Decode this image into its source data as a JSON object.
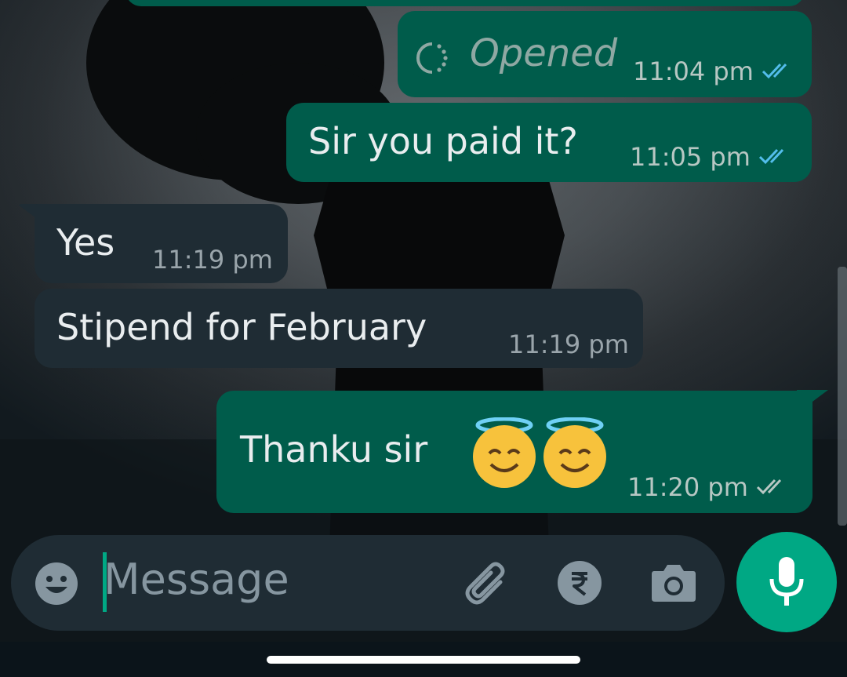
{
  "messages": [
    {
      "direction": "outgoing",
      "type": "view_once",
      "text": "Opened",
      "time": "11:04 pm",
      "status": "read"
    },
    {
      "direction": "outgoing",
      "type": "text",
      "text": "Sir you paid it?",
      "time": "11:05 pm",
      "status": "read"
    },
    {
      "direction": "incoming",
      "type": "text",
      "text": "Yes",
      "time": "11:19 pm"
    },
    {
      "direction": "incoming",
      "type": "text",
      "text": "Stipend for February",
      "time": "11:19 pm"
    },
    {
      "direction": "outgoing",
      "type": "text",
      "text": "Thanku sir",
      "emoji": [
        "smiling-face-with-halo",
        "smiling-face-with-halo"
      ],
      "time": "11:20 pm",
      "status": "delivered"
    }
  ],
  "composer": {
    "placeholder": "Message",
    "icons": [
      "emoji-icon",
      "attach-icon",
      "rupee-payment-icon",
      "camera-icon",
      "mic-icon"
    ]
  },
  "colors": {
    "outgoing_bubble": "#005c4b",
    "incoming_bubble": "#1f2c34",
    "read_tick": "#53bdeb",
    "accent": "#00a884"
  }
}
